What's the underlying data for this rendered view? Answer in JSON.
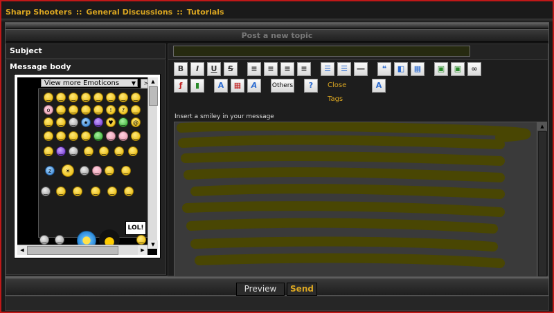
{
  "breadcrumb": {
    "items": [
      "Sharp Shooters",
      "General Discussions",
      "Tutorials"
    ],
    "separator": "::"
  },
  "post": {
    "title": "Post a new topic",
    "subject_label": "Subject",
    "subject_value": "",
    "body_label": "Message body"
  },
  "smilies": {
    "view_more_label": "View more Emoticons",
    "lol_sign": "LOL!"
  },
  "toolbar": {
    "others_label": "Others",
    "close_tags_label": "Close Tags",
    "smiley_hint": "Insert a smiley in your message"
  },
  "actions": {
    "preview_label": "Preview",
    "send_label": "Send"
  },
  "colors": {
    "accent": "#d9a521",
    "border": "#c01818",
    "scribble": "#4a4700"
  }
}
